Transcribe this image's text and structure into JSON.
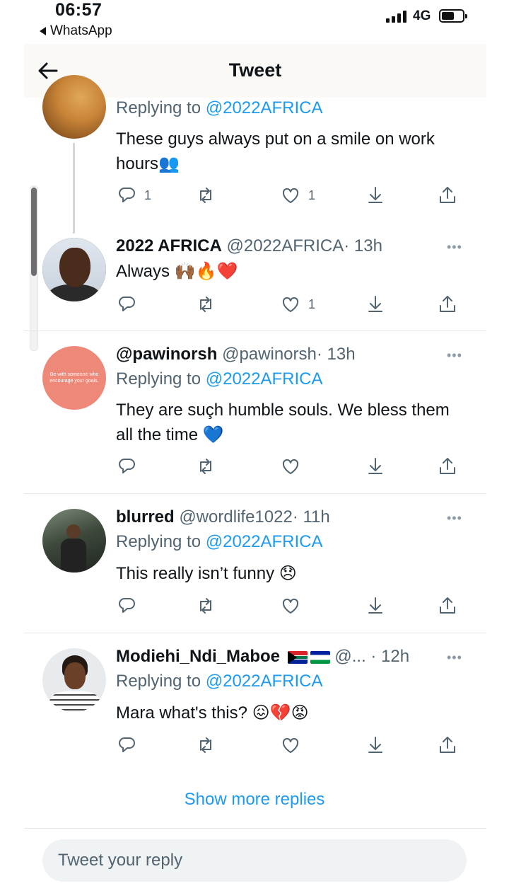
{
  "status_bar": {
    "time": "06:57",
    "back_app": "WhatsApp",
    "network": "4G"
  },
  "header": {
    "title": "Tweet"
  },
  "tweets": [
    {
      "replying_prefix": "Replying to",
      "replying_to": "@2022AFRICA",
      "text": "These guys always put on a smile on work hours",
      "text_emoji": "👥",
      "reply_count": "1",
      "like_count": "1"
    },
    {
      "name": "2022 AFRICA",
      "handle": "@2022AFRICA",
      "time": "· 13h",
      "text": "Always",
      "text_emoji": "🙌🏾🔥❤️",
      "reply_count": "",
      "like_count": "1"
    },
    {
      "name": "@pawinorsh",
      "handle": "@pawinorsh",
      "time": "· 13h",
      "avatar_text": "Be with someone who encourage your goals.",
      "replying_prefix": "Replying to",
      "replying_to": "@2022AFRICA",
      "text": "They are suçh humble souls. We bless them all the time",
      "text_emoji": "💙",
      "reply_count": "",
      "like_count": ""
    },
    {
      "name": "blurred",
      "handle": "@wordlife1022",
      "time": "· 11h",
      "replying_prefix": "Replying to",
      "replying_to": "@2022AFRICA",
      "text": "This really isn’t funny",
      "text_emoji": "😞",
      "reply_count": "",
      "like_count": ""
    },
    {
      "name": "Modiehi_Ndi_Maboe",
      "handle": "@...",
      "time": "· 12h",
      "replying_prefix": "Replying to",
      "replying_to": "@2022AFRICA",
      "text": "Mara what's this?",
      "text_emoji": "😖💔😡",
      "reply_count": "",
      "like_count": ""
    }
  ],
  "more_menu": "•••",
  "show_more": "Show more replies",
  "reply_box": {
    "placeholder": "Tweet your reply"
  },
  "colors": {
    "accent": "#1d9bf0",
    "muted": "#536471",
    "text": "#0f1419"
  }
}
